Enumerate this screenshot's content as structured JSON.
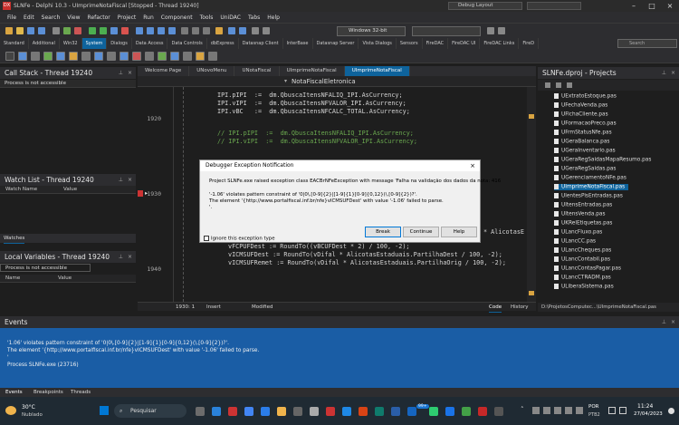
{
  "window": {
    "title": "SLNFe - Delphi 10.3 - UImprimeNotaFiscal [Stopped - Thread 19240]",
    "logo_text": "DX",
    "layout": "Debug Layout"
  },
  "menu": [
    "File",
    "Edit",
    "Search",
    "View",
    "Refactor",
    "Project",
    "Run",
    "Component",
    "Tools",
    "UniDAC",
    "Tabs",
    "Help"
  ],
  "toolbar": {
    "platform": "Windows 32-bit"
  },
  "palette_tabs": [
    "Standard",
    "Additional",
    "Win32",
    "System",
    "Dialogs",
    "Data Access",
    "Data Controls",
    "dbExpress",
    "Datasnap Client",
    "InterBase",
    "Datasnap Server",
    "Vista Dialogs",
    "Sensors",
    "FireDAC",
    "FireDAC UI",
    "FireDAC Links",
    "FireD"
  ],
  "palette_selected": "System",
  "palette_search": "Search",
  "call_stack": {
    "title": "Call Stack - Thread 19240",
    "message": "Process is not accessible"
  },
  "watch_list": {
    "title": "Watch List - Thread 19240",
    "col_name": "Watch Name",
    "col_value": "Value",
    "tab": "Watches"
  },
  "local_vars": {
    "title": "Local Variables - Thread 19240",
    "message": "Process is not accessible",
    "col_name": "Name",
    "col_value": "Value"
  },
  "editor": {
    "tabs": [
      "Welcome Page",
      "UNovoMenu",
      "UNotaFiscal",
      "UImprimeNotaFiscal",
      "UImprimeNotaFiscal"
    ],
    "selected_tab": 4,
    "class_nav": "NotaFiscalEletronica",
    "line_numbers": [
      "1920",
      "1930",
      "1940"
    ],
    "lines": [
      "IPI.pIPI  :=  dm.QbuscaItensNFALIQ_IPI.AsCurrency;",
      "IPI.vIPI  :=  dm.QbuscaItensNFVALOR_IPI.AsCurrency;",
      "IPI.vBC   :=  dm.QbuscaItensNFCALC_TOTAL.AsCurrency;",
      "",
      "// IPI.pIPI  :=  dm.QbuscaItensNFALIQ_IPI.AsCurrency;",
      "// IPI.vIPI  :=  dm.QbuscaItensNFVALOR_IPI.AsCurrency;"
    ],
    "lines_bottom": [
      "vFCPUFDest := RoundTo((vBCUFDest * 2) / 100, -2);",
      "vICMSUFDest := RoundTo(vDifal * AlicotasEstaduais.PartilhaDest / 100, -2);",
      "vICMSUFRemet := RoundTo(vDifal * AlicotasEstaduais.PartilhaOrig / 100, -2);"
    ],
    "line_tail": "* AlicotasE",
    "status_pos": "1930:  1",
    "status_mode": "Insert",
    "status_mod": "Modified",
    "view_code": "Code",
    "view_history": "History"
  },
  "projects": {
    "title": "SLNFe.dproj - Projects",
    "items": [
      "UExtratoEstoque.pas",
      "UFechaVenda.pas",
      "UFichaCliente.pas",
      "UFormacaoPreco.pas",
      "UFrmStatusNfe.pas",
      "UGeraBalanca.pas",
      "UGeraInventario.pas",
      "UGeraRegSaidasMapaResumo.pas",
      "UGeraRegSaidas.pas",
      "UGerenciamentoNFe.pas",
      "UImprimeNotaFiscal.pas",
      "UlentesPisEntradas.pas",
      "UltensEntradas.pas",
      "UltensVenda.pas",
      "UKRelEtiquetas.pas",
      "ULancFluxo.pas",
      "ULancCC.pas",
      "ULancCheques.pas",
      "ULancContabil.pas",
      "ULancContasPagar.pas",
      "ULancCTRADM.pas",
      "ULiberaSistema.pas"
    ],
    "selected": "UImprimeNotaFiscal.pas",
    "path": "D:\\ProjetosComputec...\\UImprimeNotaFiscal.pas"
  },
  "events": {
    "title": "Events",
    "lines": [
      "'1.06' violates pattern constraint of '0|0\\.[0-9]{2}|[1-9]{1}[0-9]{0,12}(\\.[0-9]{2})?'.",
      "The element '{http://www.portalfiscal.inf.br/nfe}vICMSUFDest' with value '-1.06' failed to parse.",
      "'",
      "Process SLNFe.exe (23716)"
    ],
    "tabs": [
      "Events",
      "Breakpoints",
      "Threads"
    ]
  },
  "dialog": {
    "title": "Debugger Exception Notification",
    "lines": [
      "Project SLNFe.exe raised exception class EACBrNFeException with message 'Falha na validação dos dados da nota: 416",
      "'-1.06' violates pattern constraint of '0|0\\.[0-9]{2}|[1-9]{1}[0-9]{0,12}(\\.[0-9]{2})?'.",
      "The element '{http://www.portalfiscal.inf.br/nfe}vICMSUFDest' with value '-1.06' failed to parse.",
      "'."
    ],
    "ignore_label": "Ignore this exception type",
    "btn_break": "Break",
    "btn_continue": "Continue",
    "btn_help": "Help"
  },
  "taskbar": {
    "weather_temp": "30°C",
    "weather_desc": "Nublado",
    "search": "Pesquisar",
    "badge": "99+",
    "lang": "POR",
    "kbd": "PTB2",
    "time": "11:24",
    "date": "27/04/2023"
  }
}
